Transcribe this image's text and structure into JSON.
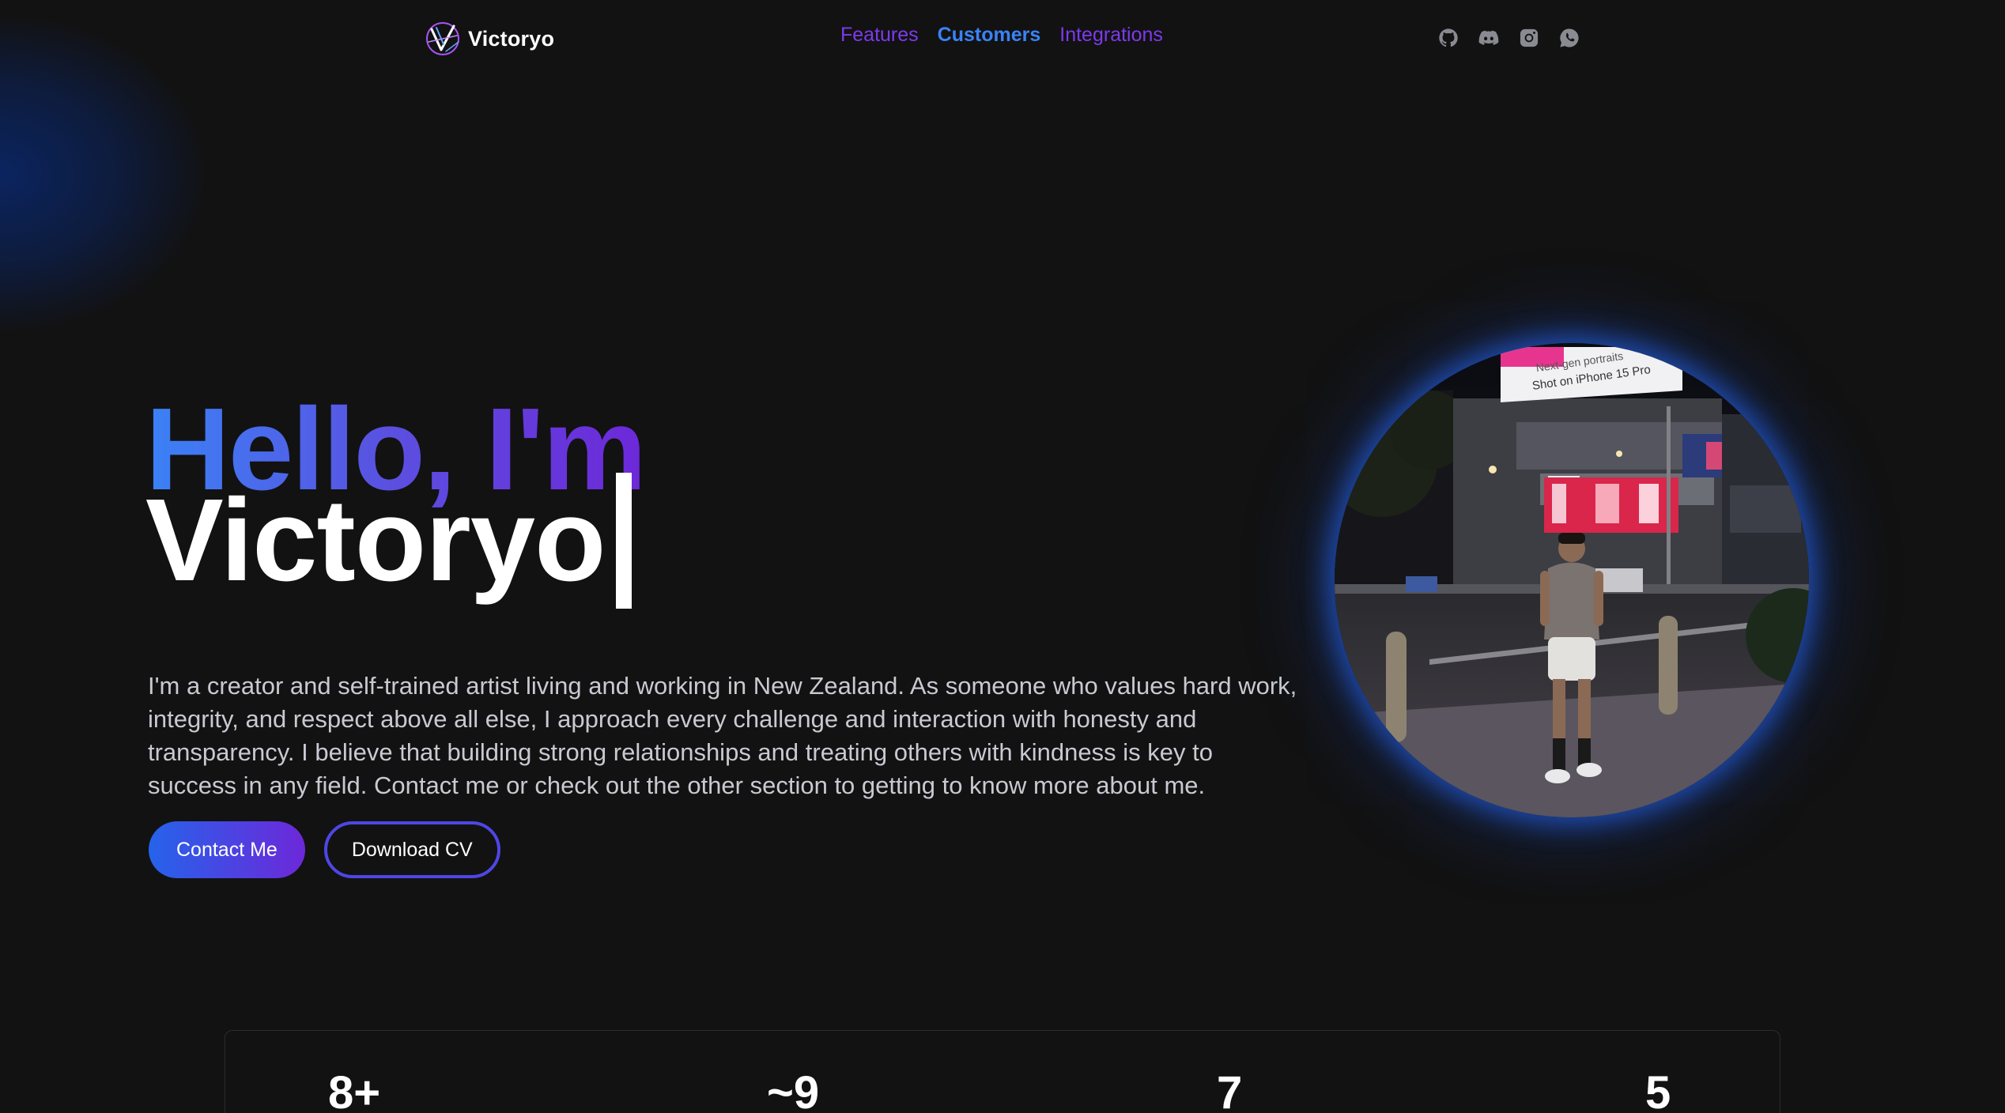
{
  "brand": {
    "name": "Victoryo",
    "logo_icon": "v-logo-icon"
  },
  "nav": {
    "links": [
      {
        "label": "Features",
        "active": false
      },
      {
        "label": "Customers",
        "active": true
      },
      {
        "label": "Integrations",
        "active": false
      }
    ]
  },
  "social": [
    {
      "icon": "github-icon"
    },
    {
      "icon": "discord-icon"
    },
    {
      "icon": "instagram-icon"
    },
    {
      "icon": "whatsapp-icon"
    }
  ],
  "hero": {
    "greeting": "Hello, I'm",
    "name": "Victoryo",
    "bio": "I'm a creator and self-trained artist living and working in New Zealand. As someone who values hard work, integrity, and respect above all else, I approach every challenge and interaction with honesty and transparency. I believe that building strong relationships and treating others with kindness is key to success in any field. Contact me or check out the other section to getting to know more about me.",
    "contact_label": "Contact Me",
    "download_label": "Download CV",
    "photo_billboard_line1": "Next-gen portraits",
    "photo_billboard_line2": "Shot on iPhone 15 Pro"
  },
  "stats": [
    {
      "value": "8+"
    },
    {
      "value": "~9"
    },
    {
      "value": "7"
    },
    {
      "value": "5"
    }
  ],
  "colors": {
    "background": "#121212",
    "accent_blue": "#3b82f6",
    "accent_purple": "#7c3aed",
    "text_primary": "#ffffff",
    "text_secondary": "#c9c9d1"
  }
}
